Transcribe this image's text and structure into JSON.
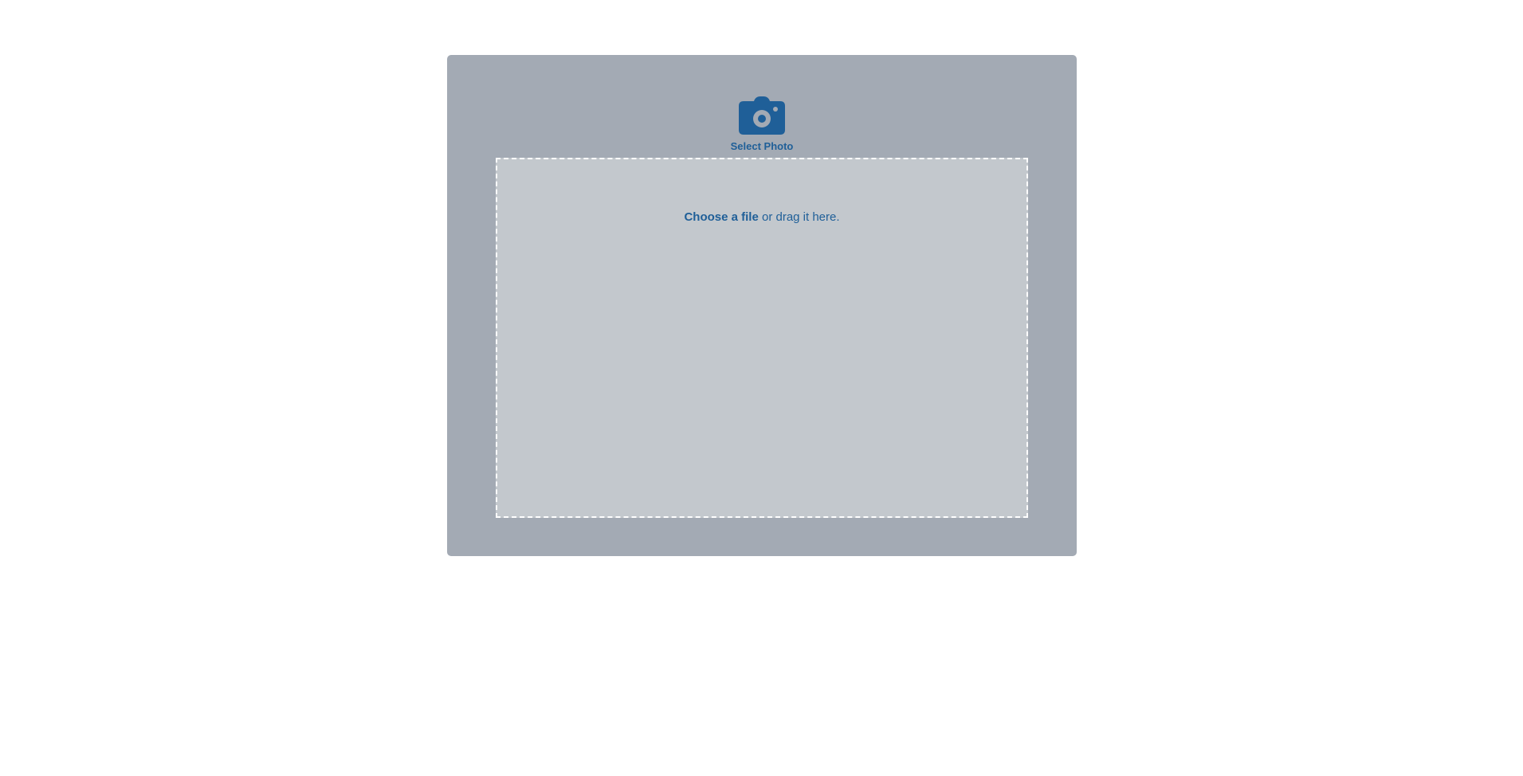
{
  "uploader": {
    "camera_icon": "camera-icon",
    "select_label": "Select Photo",
    "choose_link": "Choose a file",
    "drag_text": " or drag it here."
  },
  "colors": {
    "panel_bg": "#a3aab4",
    "dropzone_bg": "#c3c8cd",
    "accent": "#1f5f98",
    "dropzone_border": "#ffffff"
  }
}
